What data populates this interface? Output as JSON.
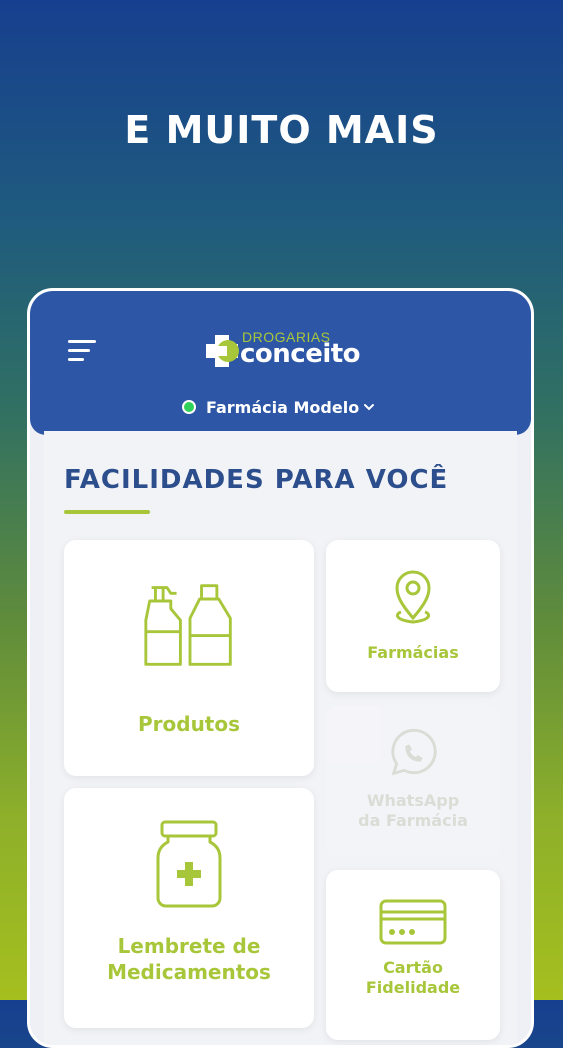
{
  "headline": "E MUITO MAIS",
  "header": {
    "logo_small": "DROGARIAS",
    "logo_big": "conceito",
    "store_name": "Farmácia Modelo"
  },
  "section": {
    "title": "FACILIDADES PARA VOCÊ"
  },
  "tiles": {
    "produtos": "Produtos",
    "farmacias": "Farmácias",
    "whatsapp_line1": "WhatsApp",
    "whatsapp_line2": "da Farmácia",
    "lembrete_line1": "Lembrete de",
    "lembrete_line2": "Medicamentos",
    "cartao_line1": "Cartão",
    "cartao_line2": "Fidelidade"
  },
  "colors": {
    "brand_blue": "#2d57a6",
    "accent_green": "#a8c63a",
    "title_blue": "#2d4e8c",
    "status_green": "#2fd15a"
  },
  "icons": [
    "menu-icon",
    "logo-cross-icon",
    "chevron-down-icon",
    "spray-bottles-icon",
    "location-pin-icon",
    "whatsapp-icon",
    "medicine-jar-icon",
    "credit-card-icon"
  ]
}
